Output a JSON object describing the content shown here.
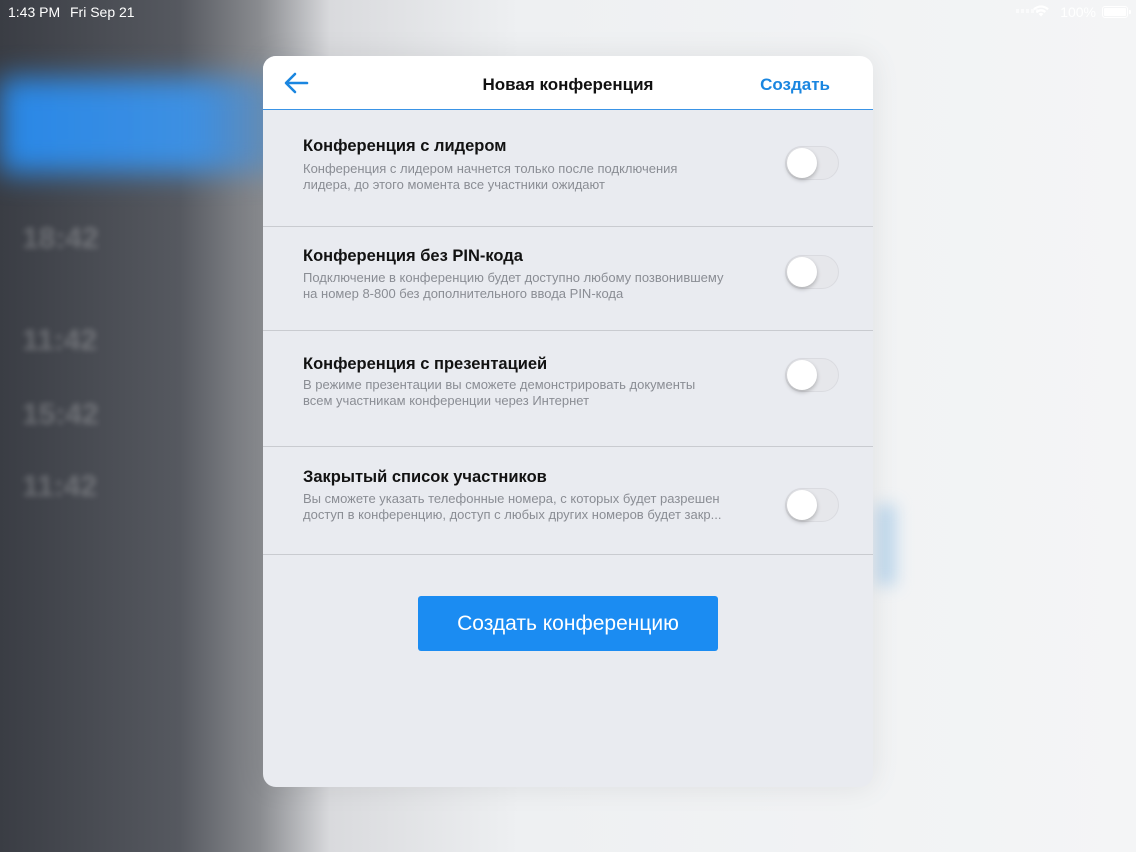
{
  "status_bar": {
    "time": "1:43 PM",
    "date": "Fri Sep 21",
    "battery": "100%"
  },
  "background": {
    "blur_texts": [
      "18:42",
      "11:42",
      "15:42",
      "11:42"
    ]
  },
  "navbar": {
    "back_icon": "arrow-left-icon",
    "title": "Новая конференция",
    "action_label": "Создать",
    "accent": "#1a86e0"
  },
  "options": [
    {
      "title": "Конференция с лидером",
      "desc_line1": "Конференция с лидером начнется только после подключения",
      "desc_line2": "лидера, до этого момента все участники ожидают",
      "enabled": false
    },
    {
      "title": "Конференция без PIN-кода",
      "desc_line1": "Подключение в конференцию будет доступно любому позвонившему",
      "desc_line2": "на номер 8-800 без дополнительного ввода PIN-кода",
      "enabled": false
    },
    {
      "title": "Конференция с презентацией",
      "desc_line1": "В режиме презентации вы сможете демонстрировать документы",
      "desc_line2": "всем участникам конференции через Интернет",
      "enabled": false
    },
    {
      "title": "Закрытый список участников",
      "desc_line1": "Вы сможете указать телефонные номера, с которых будет разрешен",
      "desc_line2": "доступ в конференцию, доступ с любых других номеров будет закр...",
      "enabled": false
    }
  ],
  "create_button": {
    "label": "Создать конференцию",
    "color": "#1b8cf2"
  }
}
